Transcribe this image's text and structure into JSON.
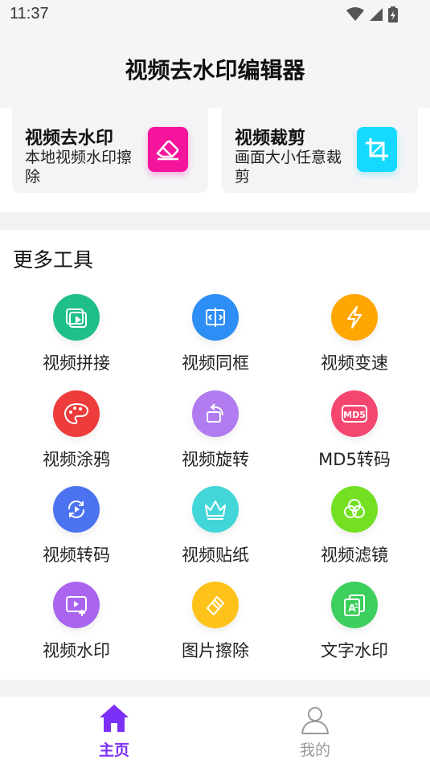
{
  "status": {
    "time": "11:37"
  },
  "header": {
    "title": "视频去水印编辑器"
  },
  "feature_cards": [
    {
      "title": "视频去水印",
      "desc": "本地视频水印擦除",
      "icon": "eraser-icon",
      "color": "#f5159c"
    },
    {
      "title": "视频裁剪",
      "desc": "画面大小任意裁剪",
      "icon": "crop-icon",
      "color": "#16d9ff"
    }
  ],
  "tools": {
    "title": "更多工具",
    "items": [
      {
        "label": "视频拼接",
        "icon": "video-splice-icon",
        "color": "#1fbf8c"
      },
      {
        "label": "视频同框",
        "icon": "split-screen-icon",
        "color": "#2d8ef5"
      },
      {
        "label": "视频变速",
        "icon": "lightning-icon",
        "color": "#ffa600"
      },
      {
        "label": "视频涂鸦",
        "icon": "palette-icon",
        "color": "#ee3b3b"
      },
      {
        "label": "视频旋转",
        "icon": "rotate-icon",
        "color": "#b07cf0"
      },
      {
        "label": "MD5转码",
        "icon": "md5-icon",
        "color": "#f4466e"
      },
      {
        "label": "视频转码",
        "icon": "transcode-icon",
        "color": "#4b73f0"
      },
      {
        "label": "视频贴纸",
        "icon": "crown-icon",
        "color": "#43d6d9"
      },
      {
        "label": "视频滤镜",
        "icon": "filter-icon",
        "color": "#74e022"
      },
      {
        "label": "视频水印",
        "icon": "video-watermark-icon",
        "color": "#a965f0"
      },
      {
        "label": "图片擦除",
        "icon": "image-erase-icon",
        "color": "#ffc21a"
      },
      {
        "label": "文字水印",
        "icon": "text-watermark-icon",
        "color": "#3ccf5d"
      }
    ]
  },
  "bottom_nav": [
    {
      "label": "主页",
      "icon": "home-icon",
      "active": true,
      "color": "#7b2ff7"
    },
    {
      "label": "我的",
      "icon": "user-icon",
      "active": false,
      "color": "#999999"
    }
  ]
}
